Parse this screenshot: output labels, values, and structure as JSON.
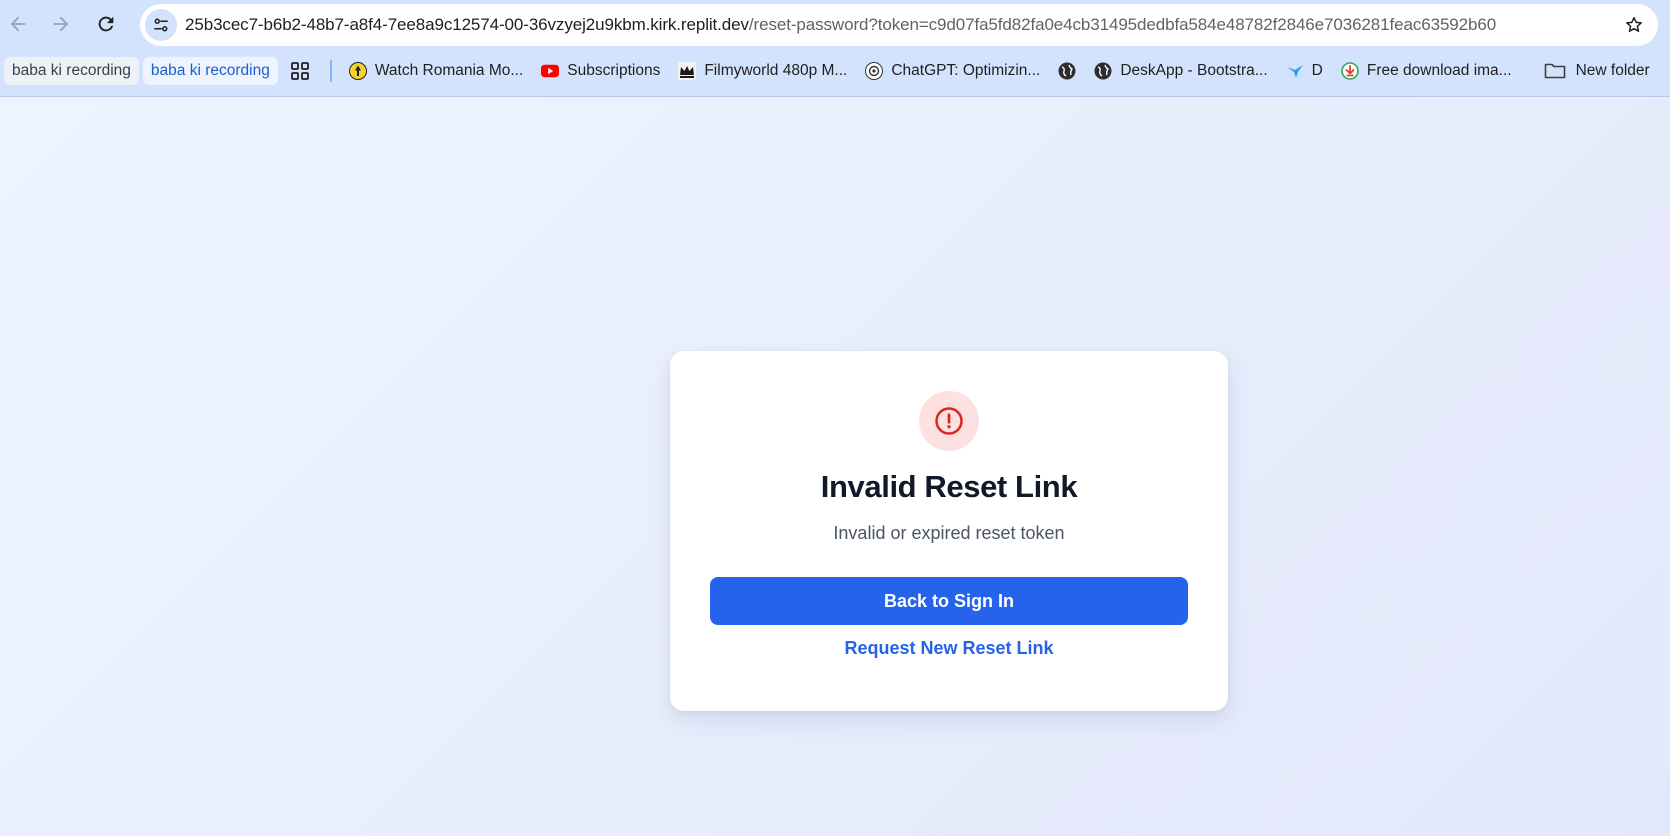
{
  "browser": {
    "url_host": "25b3cec7-b6b2-48b7-a8f4-7ee8a9c12574-00-36vzyej2u9kbm.kirk.replit.dev",
    "url_path": "/reset-password?token=c9d07fa5fd82fa0e4cb31495dedbfa584e48782f2846e7036281feac63592b60"
  },
  "bookmarks": [
    {
      "label": "baba ki recording",
      "icon": "none"
    },
    {
      "label": "baba ki recording",
      "icon": "none"
    },
    {
      "label": "Watch Romania Mo...",
      "icon": "site-icon"
    },
    {
      "label": "Subscriptions",
      "icon": "youtube-icon"
    },
    {
      "label": "Filmyworld 480p M...",
      "icon": "crown-icon"
    },
    {
      "label": "ChatGPT: Optimizin...",
      "icon": "chatgpt-icon"
    },
    {
      "label": "DeskApp - Bootstra...",
      "icon": "globe-icon"
    },
    {
      "label": "D",
      "icon": "bird-icon"
    },
    {
      "label": "Free download ima...",
      "icon": "download-icon"
    },
    {
      "label": "New folder",
      "icon": "folder-icon"
    }
  ],
  "card": {
    "title": "Invalid Reset Link",
    "subtitle": "Invalid or expired reset token",
    "primary_button": "Back to Sign In",
    "secondary_link": "Request New Reset Link"
  },
  "colors": {
    "primary": "#2563eb",
    "alert_bg": "#fde0e0",
    "alert_icon": "#dc2626"
  }
}
